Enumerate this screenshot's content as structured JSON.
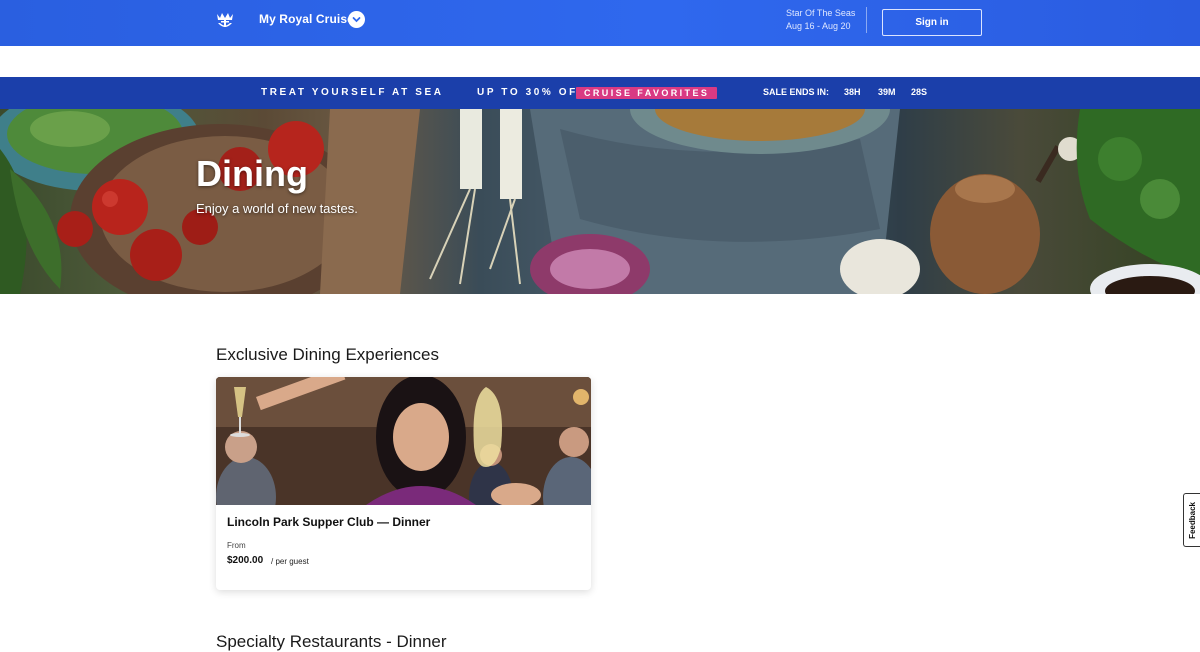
{
  "header": {
    "cruise_title": "My Royal Cruise",
    "ship_name": "Star Of The Seas",
    "dates": "Aug 16 - Aug 20",
    "signin_label": "Sign in",
    "logo_icon": "crown-anchor-icon"
  },
  "sale_banner": {
    "tagline": "TREAT YOURSELF AT SEA",
    "offer": "UP TO 30% OFF",
    "offer_pill": "CRUISE FAVORITES",
    "ends_label": "SALE ENDS IN:",
    "hours": "38H",
    "minutes": "39M",
    "seconds": "28S",
    "pill_color": "#d93a83",
    "background_color": "#1b3faa"
  },
  "hero": {
    "title": "Dining",
    "subtitle": "Enjoy a world of new tastes."
  },
  "sections": [
    {
      "title": "Exclusive Dining Experiences",
      "cards": [
        {
          "title": "Lincoln Park Supper Club — Dinner",
          "from_label": "From",
          "price": "$200.00",
          "per_label": "/ per guest"
        }
      ]
    },
    {
      "title": "Specialty Restaurants - Dinner"
    }
  ],
  "feedback_label": "Feedback",
  "colors": {
    "header_blue": "#2f68ee"
  }
}
